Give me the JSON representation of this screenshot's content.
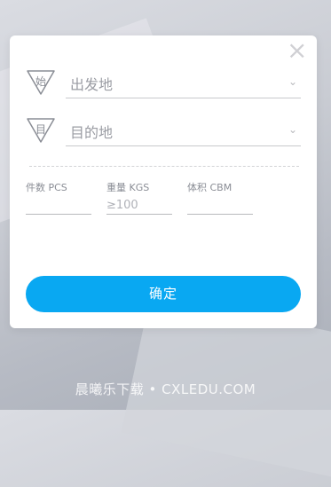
{
  "colors": {
    "accent": "#09a8f2",
    "close": "#d0d0d4"
  },
  "form": {
    "close_icon": "close-icon",
    "origin": {
      "badge": "始",
      "label": "出发地",
      "icon": "chevron-down-icon"
    },
    "destination": {
      "badge": "目",
      "label": "目的地",
      "icon": "chevron-down-icon"
    },
    "pieces": {
      "label": "件数 PCS",
      "placeholder": ""
    },
    "weight": {
      "label": "重量 KGS",
      "placeholder": "≥100"
    },
    "volume": {
      "label": "体积 CBM",
      "placeholder": ""
    },
    "confirm_label": "确定"
  },
  "watermark": "晨曦乐下载 • CXLEDU.COM"
}
